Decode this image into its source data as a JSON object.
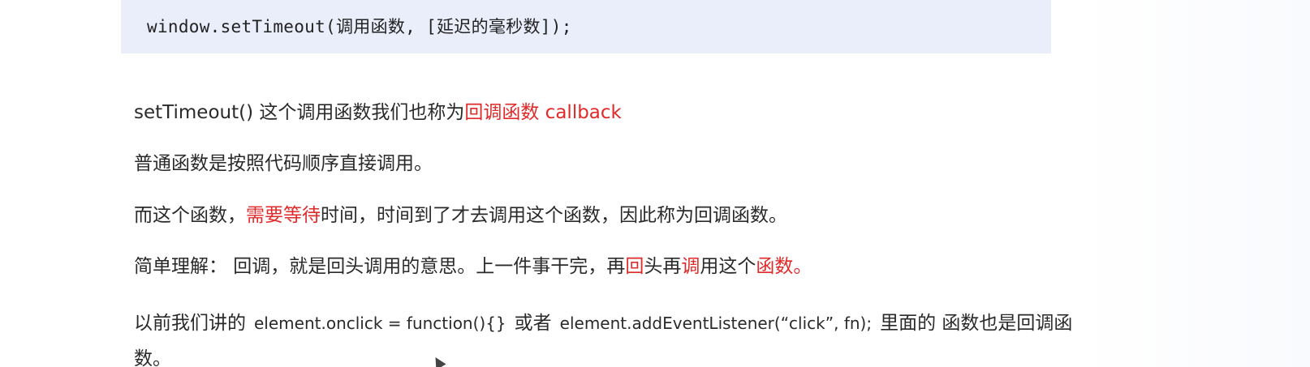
{
  "code": {
    "line": "window.setTimeout(调用函数, [延迟的毫秒数]);"
  },
  "paragraphs": {
    "p1": {
      "text": "setTimeout()  这个调用函数我们也称为",
      "highlight": "回调函数 callback"
    },
    "p2": {
      "text": "普通函数是按照代码顺序直接调用。"
    },
    "p3": {
      "before": "而这个函数，",
      "highlight": "需要等待",
      "after": "时间，时间到了才去调用这个函数，因此称为回调函数。"
    },
    "p4": {
      "before": "简单理解： 回调，就是回头调用的意思。上一件事干完，再",
      "h1": "回",
      "mid1": "头再",
      "h2": "调",
      "mid2": "用这个",
      "h3": "函数。"
    },
    "p5": {
      "prefix": "以前我们讲的",
      "code1": "element.onclick = function(){}",
      "mid": "或者",
      "code2": "element.addEventListener(“click”, fn);",
      "suffix": "里面的 函数也是回调函数。"
    }
  },
  "colors": {
    "highlight": "#e02a2a",
    "code_background": "#eaeefb"
  }
}
